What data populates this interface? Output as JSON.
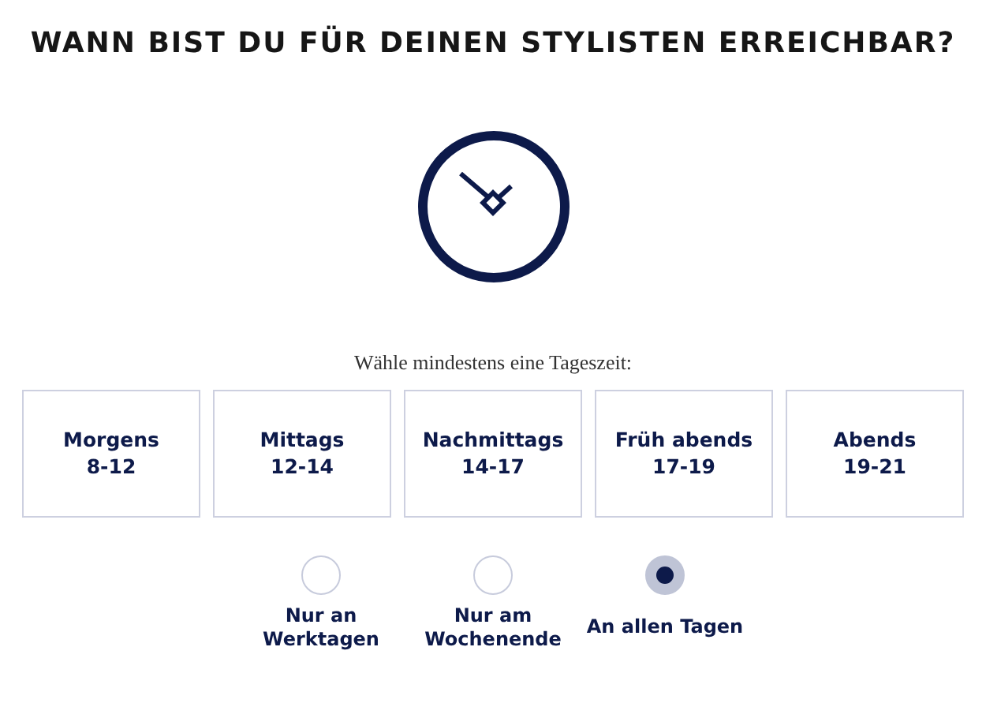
{
  "title": "WANN BIST DU FÜR DEINEN STYLISTEN ERREICHBAR?",
  "instruction": "Wähle mindestens eine Tageszeit:",
  "time_slots": [
    {
      "label": "Morgens",
      "hours": "8-12",
      "selected": false
    },
    {
      "label": "Mittags",
      "hours": "12-14",
      "selected": false
    },
    {
      "label": "Nachmittags",
      "hours": "14-17",
      "selected": false
    },
    {
      "label": "Früh abends",
      "hours": "17-19",
      "selected": false
    },
    {
      "label": "Abends",
      "hours": "19-21",
      "selected": false
    }
  ],
  "day_options": [
    {
      "label": "Nur an\nWerktagen",
      "selected": false
    },
    {
      "label": "Nur am\nWochenende",
      "selected": false
    },
    {
      "label": "An allen Tagen",
      "selected": true
    }
  ]
}
